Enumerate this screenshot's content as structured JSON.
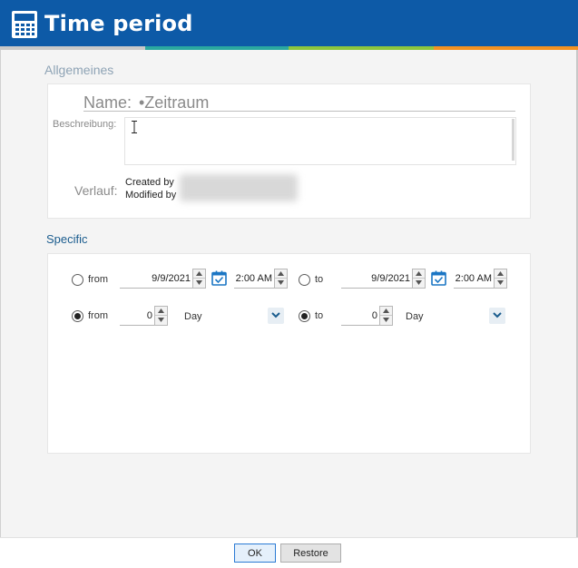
{
  "window": {
    "title": "Time period",
    "app_icon": "calculator-icon"
  },
  "general": {
    "section_label": "Allgemeines",
    "name_label": "Name:",
    "name_value": "•Zeitraum",
    "description_label": "Beschreibung:",
    "description_value": "",
    "history_label": "Verlauf:",
    "created_by_label": "Created by",
    "modified_by_label": "Modified by"
  },
  "specific": {
    "section_label": "Specific",
    "rows": [
      {
        "from_label": "from",
        "from_checked": false,
        "from_date": "9/9/2021",
        "from_time": "2:00 AM",
        "to_label": "to",
        "to_checked": false,
        "to_date": "9/9/2021",
        "to_time": "2:00 AM"
      },
      {
        "from_label": "from",
        "from_checked": true,
        "from_value": "0",
        "from_unit": "Day",
        "to_label": "to",
        "to_checked": true,
        "to_value": "0",
        "to_unit": "Day"
      }
    ]
  },
  "footer": {
    "ok_label": "OK",
    "restore_label": "Restore"
  },
  "colors": {
    "titlebar": "#0d5aa7",
    "stripe_gray": "#c9c9c9",
    "stripe_teal": "#2aa8a0",
    "stripe_green": "#8cc63f",
    "stripe_orange": "#f29222",
    "specific_label": "#1a5c8e"
  }
}
